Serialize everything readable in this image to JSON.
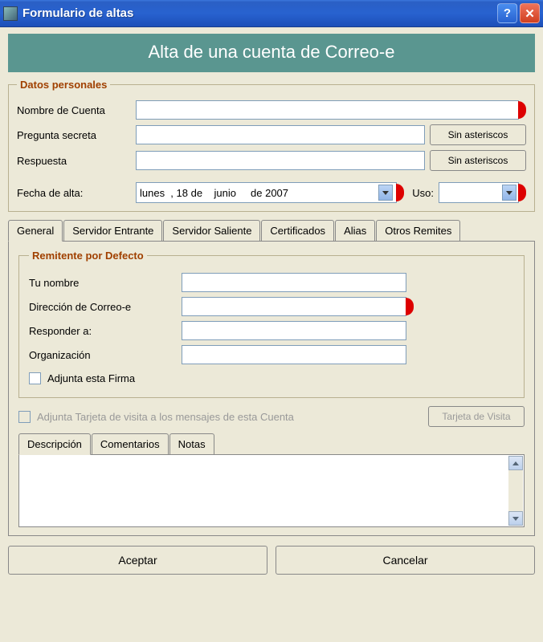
{
  "titlebar": {
    "title": "Formulario de altas"
  },
  "banner": "Alta de una cuenta de Correo-e",
  "personal": {
    "legend": "Datos personales",
    "account_label": "Nombre de Cuenta",
    "account_value": "",
    "secret_q_label": "Pregunta secreta",
    "secret_q_value": "",
    "answer_label": "Respuesta",
    "answer_value": "",
    "no_asterisks_btn": "Sin asteriscos",
    "date_label": "Fecha de alta:",
    "date_value": "lunes  , 18 de    junio     de 2007",
    "uso_label": "Uso:",
    "uso_value": ""
  },
  "tabs": {
    "general": "General",
    "incoming": "Servidor Entrante",
    "outgoing": "Servidor Saliente",
    "certs": "Certificados",
    "alias": "Alias",
    "others": "Otros Remites"
  },
  "sender": {
    "legend": "Remitente por Defecto",
    "name_label": "Tu nombre",
    "name_value": "",
    "email_label": "Dirección de Correo-e",
    "email_value": "",
    "reply_label": "Responder a:",
    "reply_value": "",
    "org_label": "Organización",
    "org_value": "",
    "sig_label": "Adjunta esta Firma",
    "vcard_label": "Adjunta Tarjeta de visita a los mensajes de esta Cuenta",
    "vcard_btn": "Tarjeta de Visita"
  },
  "subtabs": {
    "desc": "Descripción",
    "comments": "Comentarios",
    "notes": "Notas"
  },
  "footer": {
    "accept": "Aceptar",
    "cancel": "Cancelar"
  }
}
